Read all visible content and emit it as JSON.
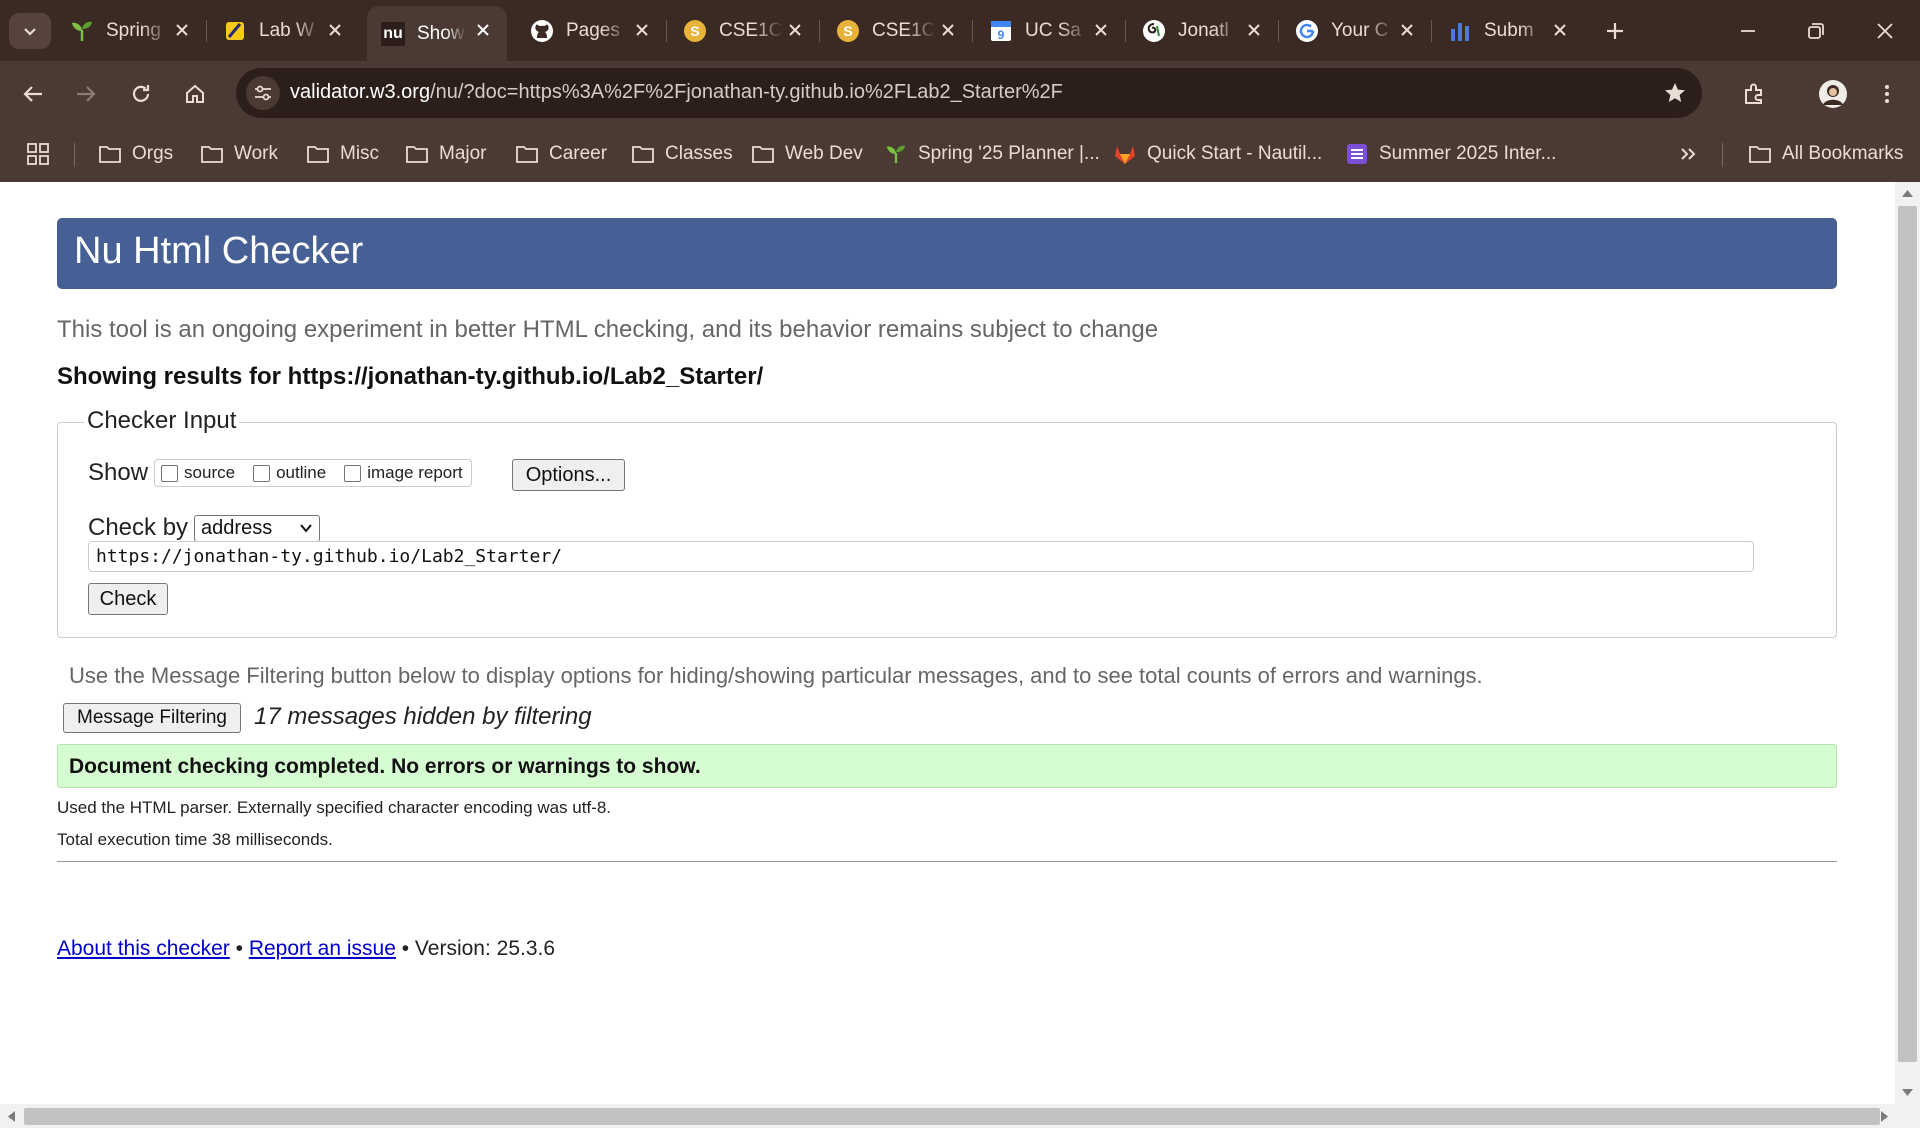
{
  "browser": {
    "tabs": [
      {
        "title": "Spring",
        "icon": "sprout-icon"
      },
      {
        "title": "Lab W",
        "icon": "pencil-ruler-icon"
      },
      {
        "title": "Show",
        "icon": "nu-icon",
        "active": true
      },
      {
        "title": "Pages",
        "icon": "github-icon"
      },
      {
        "title": "CSE1C",
        "icon": "coin-s-icon"
      },
      {
        "title": "CSE1C",
        "icon": "coin-s-icon"
      },
      {
        "title": "UC Sa",
        "icon": "calendar-9-icon"
      },
      {
        "title": "Jonatl",
        "icon": "swirl-icon"
      },
      {
        "title": "Your C",
        "icon": "google-icon"
      },
      {
        "title": "Subm",
        "icon": "bar-chart-icon"
      }
    ],
    "url": {
      "host": "validator.w3.org",
      "rest": "/nu/?doc=https%3A%2F%2Fjonathan-ty.github.io%2FLab2_Starter%2F"
    },
    "bookmarks": [
      {
        "label": "Orgs",
        "icon": "folder-icon"
      },
      {
        "label": "Work",
        "icon": "folder-icon"
      },
      {
        "label": "Misc",
        "icon": "folder-icon"
      },
      {
        "label": "Major",
        "icon": "folder-icon"
      },
      {
        "label": "Career",
        "icon": "folder-icon"
      },
      {
        "label": "Classes",
        "icon": "folder-icon"
      },
      {
        "label": "Web Dev",
        "icon": "folder-icon"
      },
      {
        "label": "Spring '25 Planner |...",
        "icon": "sprout-icon"
      },
      {
        "label": "Quick Start - Nautil...",
        "icon": "gitlab-icon"
      },
      {
        "label": "Summer 2025 Inter...",
        "icon": "list-icon"
      }
    ],
    "all_bookmarks": "All Bookmarks",
    "colors": {
      "frame": "#3b2a24",
      "toolbar": "#4a3a33",
      "omnibox": "#2c1f1b"
    }
  },
  "page": {
    "title": "Nu Html Checker",
    "intro": "This tool is an ongoing experiment in better HTML checking, and its behavior remains subject to change",
    "results_for": "Showing results for https://jonathan-ty.github.io/Lab2_Starter/",
    "checker_input": {
      "legend": "Checker Input",
      "show_label": "Show",
      "checkboxes": [
        {
          "label": "source",
          "checked": false
        },
        {
          "label": "outline",
          "checked": false
        },
        {
          "label": "image report",
          "checked": false
        }
      ],
      "options_button": "Options...",
      "check_by_label": "Check by",
      "check_by_value": "address",
      "url_value": "https://jonathan-ty.github.io/Lab2_Starter/",
      "check_button": "Check"
    },
    "filter_note": "Use the Message Filtering button below to display options for hiding/showing particular messages, and to see total counts of errors and warnings.",
    "message_filtering_button": "Message Filtering",
    "hidden_count": "17 messages hidden by filtering",
    "success": "Document checking completed. No errors or warnings to show.",
    "parser_info": "Used the HTML parser. Externally specified character encoding was utf-8.",
    "execution_time": "Total execution time 38 milliseconds.",
    "footer": {
      "about": "About this checker",
      "sep1": "•",
      "report": "Report an issue",
      "version": "• Version: 25.3.6"
    },
    "colors": {
      "header": "#465f94",
      "success_bg": "#d6fcd2",
      "link": "#0000cc"
    }
  }
}
